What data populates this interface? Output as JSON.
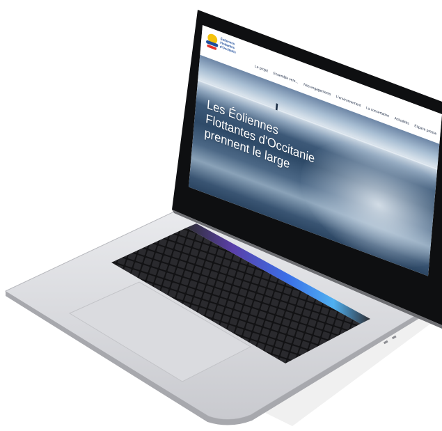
{
  "site": {
    "logo_lines": [
      "Éoliennes",
      "Flottantes",
      "d'Occitanie"
    ],
    "nav": [
      "Le projet",
      "Ensemble vers...",
      "Nos engagements",
      "L'environnement",
      "La concertation",
      "Actualités",
      "Espace presse"
    ],
    "hero_title_lines": [
      "Les Éoliennes",
      "Flottantes d'Occitanie",
      "prennent le large"
    ]
  },
  "colors": {
    "logo_blue": "#1f4e9c",
    "logo_yellow": "#f4c20d",
    "logo_red": "#e4342b",
    "nav_text": "#1c2a44",
    "laptop_silver": "#d8d9dc",
    "keyboard": "#1b1b1d",
    "touchbar_accent": "#3d63ff"
  }
}
